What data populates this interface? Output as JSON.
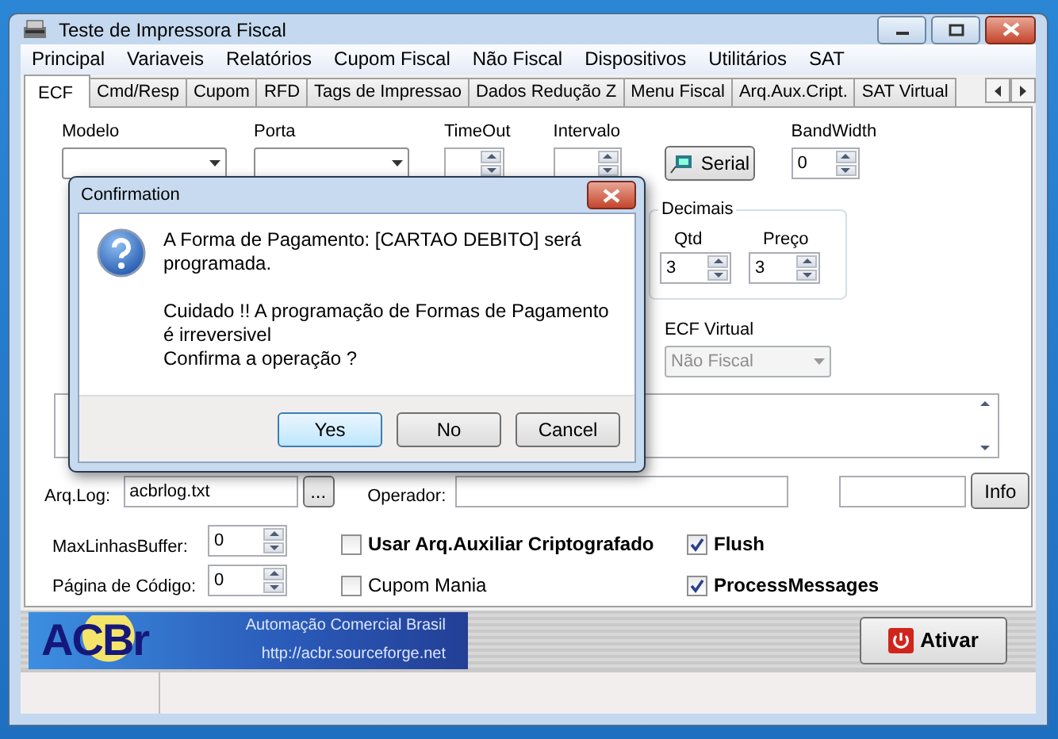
{
  "window": {
    "title": "Teste de Impressora Fiscal"
  },
  "menu": [
    "Principal",
    "Variaveis",
    "Relatórios",
    "Cupom Fiscal",
    "Não Fiscal",
    "Dispositivos",
    "Utilitários",
    "SAT"
  ],
  "tabs": [
    {
      "label": "ECF",
      "selected": true
    },
    {
      "label": "Cmd/Resp",
      "selected": false
    },
    {
      "label": "Cupom",
      "selected": false
    },
    {
      "label": "RFD",
      "selected": false
    },
    {
      "label": "Tags de Impressao",
      "selected": false
    },
    {
      "label": "Dados Redução Z",
      "selected": false
    },
    {
      "label": "Menu Fiscal",
      "selected": false
    },
    {
      "label": "Arq.Aux.Cript.",
      "selected": false
    },
    {
      "label": "SAT Virtual",
      "selected": false
    }
  ],
  "ecf": {
    "modelo": {
      "label": "Modelo"
    },
    "porta": {
      "label": "Porta"
    },
    "timeout": {
      "label": "TimeOut"
    },
    "intervalo": {
      "label": "Intervalo"
    },
    "serial_button": "Serial",
    "bandwidth": {
      "label": "BandWidth",
      "value": "0"
    },
    "decimais": {
      "title": "Decimais",
      "qtd": {
        "label": "Qtd",
        "value": "3"
      },
      "preco": {
        "label": "Preço",
        "value": "3"
      }
    },
    "ecf_virtual": {
      "label": "ECF Virtual",
      "value": "Não Fiscal",
      "disabled": true
    },
    "arq_log": {
      "label": "Arq.Log:",
      "value": "acbrlog.txt"
    },
    "browse_button": "...",
    "operador": {
      "label": "Operador:"
    },
    "info_button": "Info",
    "max_linhas_buffer": {
      "label": "MaxLinhasBuffer:",
      "value": "0"
    },
    "pagina_codigo": {
      "label": "Página de Código:",
      "value": "0"
    },
    "checkboxes": [
      {
        "label": "Usar Arq.Auxiliar Criptografado",
        "checked": false,
        "bold": true
      },
      {
        "label": "Flush",
        "checked": true,
        "bold": true
      },
      {
        "label": "Cupom Mania",
        "checked": false,
        "bold": false
      },
      {
        "label": "ProcessMessages",
        "checked": true,
        "bold": true
      }
    ]
  },
  "banner": {
    "logo": "ACBr",
    "line1": "Automação Comercial Brasil",
    "line2": "http://acbr.sourceforge.net"
  },
  "ativar_button": "Ativar",
  "dialog": {
    "title": "Confirmation",
    "paragraphs": [
      "A Forma de Pagamento: [CARTAO DEBITO] será programada.",
      "Cuidado !! A programação de Formas de Pagamento é irreversivel\nConfirma a operação ?"
    ],
    "buttons": [
      {
        "label": "Yes",
        "default": true
      },
      {
        "label": "No",
        "default": false
      },
      {
        "label": "Cancel",
        "default": false
      }
    ]
  }
}
